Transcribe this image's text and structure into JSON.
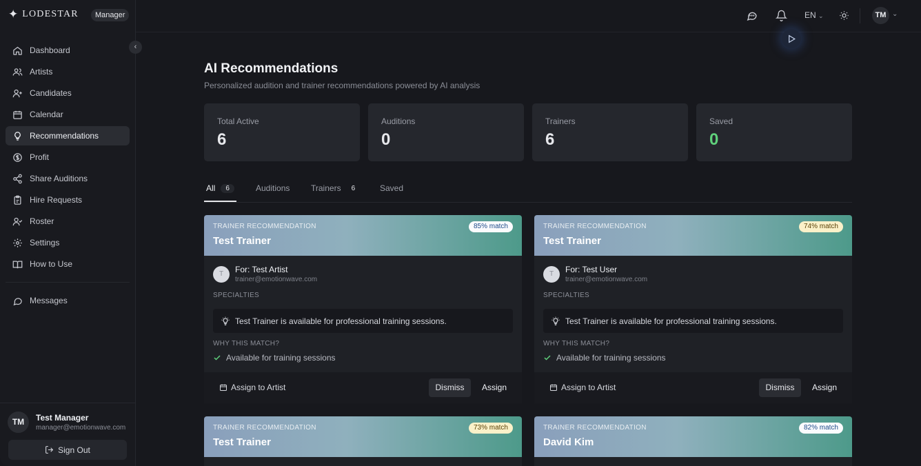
{
  "brand": {
    "name": "LODESTAR",
    "role": "Manager"
  },
  "sidebar": {
    "items": [
      {
        "label": "Dashboard",
        "icon": "home-icon"
      },
      {
        "label": "Artists",
        "icon": "users-icon"
      },
      {
        "label": "Candidates",
        "icon": "user-plus-icon"
      },
      {
        "label": "Calendar",
        "icon": "calendar-icon"
      },
      {
        "label": "Recommendations",
        "icon": "lightbulb-icon",
        "active": true
      },
      {
        "label": "Profit",
        "icon": "dollar-circle-icon"
      },
      {
        "label": "Share Auditions",
        "icon": "share-icon"
      },
      {
        "label": "Hire Requests",
        "icon": "clipboard-icon"
      },
      {
        "label": "Roster",
        "icon": "user-check-icon"
      },
      {
        "label": "Settings",
        "icon": "gear-icon"
      },
      {
        "label": "How to Use",
        "icon": "book-icon"
      }
    ],
    "messages_label": "Messages",
    "user": {
      "initials": "TM",
      "name": "Test Manager",
      "email": "manager@emotionwave.com"
    },
    "sign_out": "Sign Out"
  },
  "topbar": {
    "language": "EN",
    "user_initials": "TM"
  },
  "page": {
    "title": "AI Recommendations",
    "subtitle": "Personalized audition and trainer recommendations powered by AI analysis"
  },
  "stats": [
    {
      "label": "Total Active",
      "value": "6"
    },
    {
      "label": "Auditions",
      "value": "0"
    },
    {
      "label": "Trainers",
      "value": "6"
    },
    {
      "label": "Saved",
      "value": "0"
    }
  ],
  "tabs": [
    {
      "label": "All",
      "count": "6"
    },
    {
      "label": "Auditions",
      "count": ""
    },
    {
      "label": "Trainers",
      "count": "6"
    },
    {
      "label": "Saved",
      "count": ""
    }
  ],
  "cards": [
    {
      "kind": "TRAINER RECOMMENDATION",
      "name": "Test Trainer",
      "match": "85% match",
      "for": "For: Test Artist",
      "email": "trainer@emotionwave.com",
      "avatar": "T",
      "specialties_label": "SPECIALTIES",
      "specialty": "Test Trainer is available for professional training sessions.",
      "why_label": "WHY THIS MATCH?",
      "why": "Available for training sessions",
      "assign_artist": "Assign to Artist",
      "dismiss": "Dismiss",
      "assign": "Assign"
    },
    {
      "kind": "TRAINER RECOMMENDATION",
      "name": "Test Trainer",
      "match": "74% match",
      "for": "For: Test User",
      "email": "trainer@emotionwave.com",
      "avatar": "T",
      "specialties_label": "SPECIALTIES",
      "specialty": "Test Trainer is available for professional training sessions.",
      "why_label": "WHY THIS MATCH?",
      "why": "Available for training sessions",
      "assign_artist": "Assign to Artist",
      "dismiss": "Dismiss",
      "assign": "Assign"
    },
    {
      "kind": "TRAINER RECOMMENDATION",
      "name": "Test Trainer",
      "match": "73% match"
    },
    {
      "kind": "TRAINER RECOMMENDATION",
      "name": "David Kim",
      "match": "82% match"
    }
  ],
  "colors": {
    "accent_green": "#5fd07b",
    "background": "#17181d",
    "panel": "#25272d"
  }
}
